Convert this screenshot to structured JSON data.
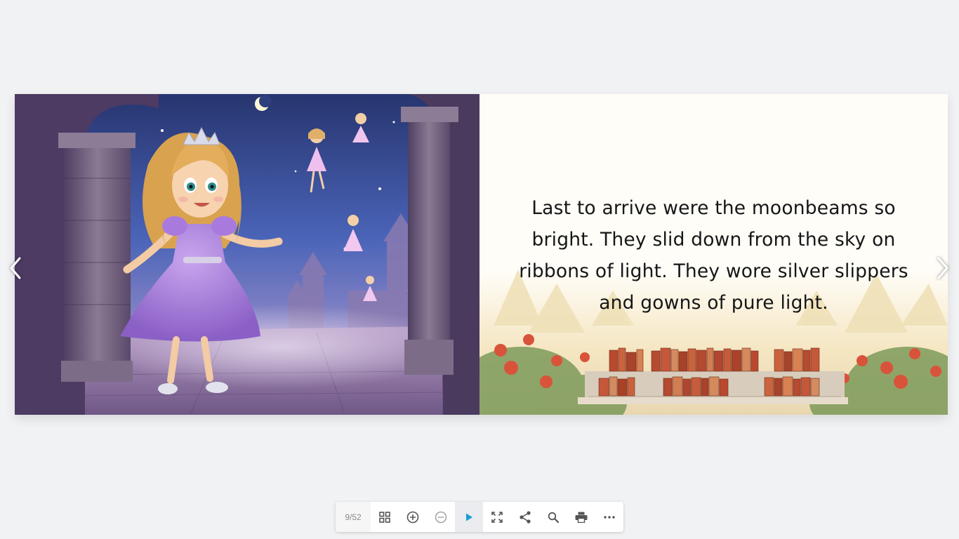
{
  "viewer": {
    "page_counter": "9/52",
    "page_text": "Last to arrive were the moonbeams so bright. They slid down from the sky on ribbons of light. They wore silver slippers and gowns of pure light."
  },
  "toolbar": {
    "buttons": [
      {
        "name": "thumbnails-button",
        "icon": "grid-icon"
      },
      {
        "name": "zoom-in-button",
        "icon": "zoom-in-icon"
      },
      {
        "name": "zoom-out-button",
        "icon": "zoom-out-icon"
      },
      {
        "name": "play-button",
        "icon": "play-icon"
      },
      {
        "name": "fullscreen-button",
        "icon": "fullscreen-icon"
      },
      {
        "name": "share-button",
        "icon": "share-icon"
      },
      {
        "name": "search-button",
        "icon": "search-icon"
      },
      {
        "name": "print-button",
        "icon": "print-icon"
      },
      {
        "name": "more-button",
        "icon": "more-icon"
      }
    ]
  },
  "colors": {
    "background": "#f1f2f4",
    "accent": "#1e9bd7",
    "icon": "#555555"
  }
}
